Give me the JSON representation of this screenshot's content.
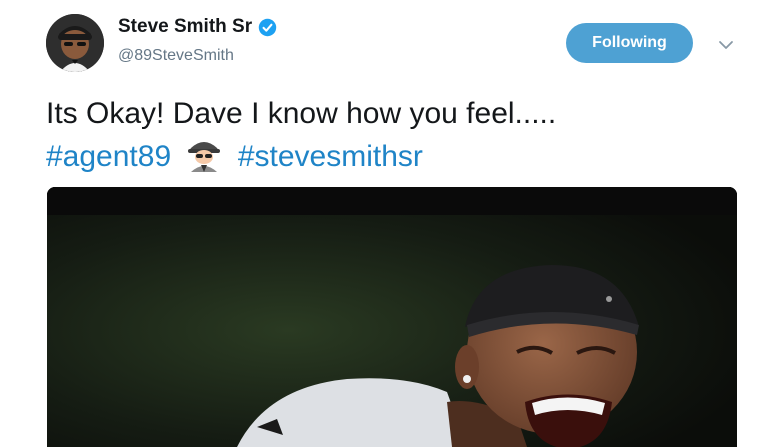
{
  "user": {
    "display_name": "Steve Smith Sr",
    "handle": "@89SteveSmith",
    "verified": true
  },
  "follow_button": {
    "label": "Following"
  },
  "tweet": {
    "text": "Its Okay! Dave I know how you feel.....",
    "hashtags": [
      "#agent89",
      "#stevesmithsr"
    ],
    "emoji": "sleuth-or-spy-icon"
  },
  "media": {
    "type": "photo"
  },
  "colors": {
    "accent": "#4ea1d3",
    "hashtag": "#1f84c7",
    "verified": "#1da1f2",
    "secondary_text": "#657786"
  }
}
